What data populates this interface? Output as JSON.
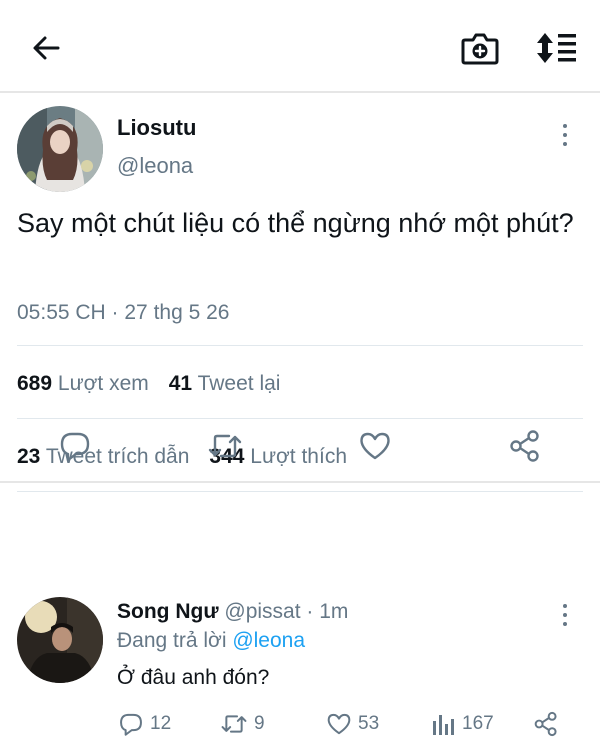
{
  "header": {
    "back_icon": "arrow-left-icon",
    "camera_icon": "camera-plus-icon",
    "sort_icon": "sort-list-icon"
  },
  "tweet": {
    "author_name": "Liosutu",
    "author_handle": "@leona",
    "text": "Say một chút liệu có thể ngừng nhớ một phút?",
    "timestamp": "05:55 CH · 27 thg 5 26",
    "stats": {
      "views_count": "689",
      "views_label": "Lượt xem",
      "retweets_count": "41",
      "retweets_label": "Tweet lại",
      "quotes_count": "23",
      "quotes_label": "Tweet trích dẫn",
      "likes_count": "344",
      "likes_label": "Lượt thích"
    },
    "actions": [
      "reply-icon",
      "retweet-icon",
      "like-icon",
      "share-icon"
    ]
  },
  "reply": {
    "author_name": "Song Ngư",
    "author_handle": "@pissat",
    "time": "· 1m",
    "replying_prefix": "Đang trả lời",
    "replying_to": "@leona",
    "text": "Ở đâu anh đón?",
    "reply_count": "12",
    "retweet_count": "9",
    "like_count": "53",
    "view_count": "167"
  },
  "colors": {
    "text": "#0f1419",
    "secondary": "#657786",
    "link": "#1da1f2",
    "divider": "#e1e8ed"
  }
}
